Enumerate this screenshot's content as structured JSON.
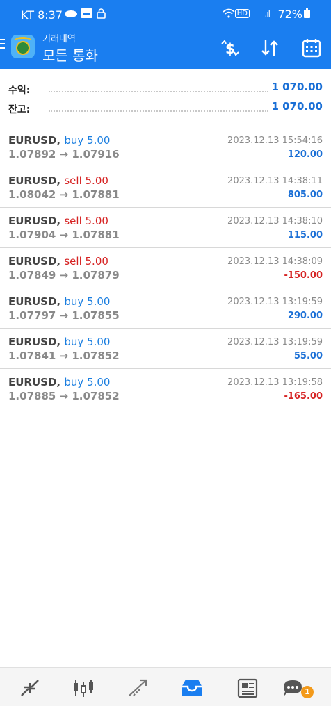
{
  "status": {
    "time": "KT 8:37",
    "battery": "72%",
    "hd": "HD",
    "signal": ".ıl"
  },
  "header": {
    "subtitle": "거래내역",
    "title": "모든 통화"
  },
  "summary": {
    "profit_label": "수익:",
    "profit_value": "1 070.00",
    "balance_label": "잔고:",
    "balance_value": "1 070.00"
  },
  "deals": [
    {
      "symbol": "EURUSD,",
      "side": "buy",
      "side_label": "buy 5.00",
      "prices": "1.07892 → 1.07916",
      "time": "2023.12.13 15:54:16",
      "profit": "120.00"
    },
    {
      "symbol": "EURUSD,",
      "side": "sell",
      "side_label": "sell 5.00",
      "prices": "1.08042 → 1.07881",
      "time": "2023.12.13 14:38:11",
      "profit": "805.00"
    },
    {
      "symbol": "EURUSD,",
      "side": "sell",
      "side_label": "sell 5.00",
      "prices": "1.07904 → 1.07881",
      "time": "2023.12.13 14:38:10",
      "profit": "115.00"
    },
    {
      "symbol": "EURUSD,",
      "side": "sell",
      "side_label": "sell 5.00",
      "prices": "1.07849 → 1.07879",
      "time": "2023.12.13 14:38:09",
      "profit": "-150.00"
    },
    {
      "symbol": "EURUSD,",
      "side": "buy",
      "side_label": "buy 5.00",
      "prices": "1.07797 → 1.07855",
      "time": "2023.12.13 13:19:59",
      "profit": "290.00"
    },
    {
      "symbol": "EURUSD,",
      "side": "buy",
      "side_label": "buy 5.00",
      "prices": "1.07841 → 1.07852",
      "time": "2023.12.13 13:19:59",
      "profit": "55.00"
    },
    {
      "symbol": "EURUSD,",
      "side": "buy",
      "side_label": "buy 5.00",
      "prices": "1.07885 → 1.07852",
      "time": "2023.12.13 13:19:58",
      "profit": "-165.00"
    }
  ],
  "bottom_nav": {
    "items": [
      "quotes-icon",
      "chart-icon",
      "trade-icon",
      "history-icon",
      "news-icon",
      "chat-icon"
    ],
    "active": "history-icon",
    "chat_badge": "1"
  },
  "colors": {
    "accent": "#1a7ef0",
    "buy": "#1a7ee0",
    "sell": "#d62222",
    "profit_positive": "#1a6fd6",
    "profit_negative": "#d62222"
  }
}
